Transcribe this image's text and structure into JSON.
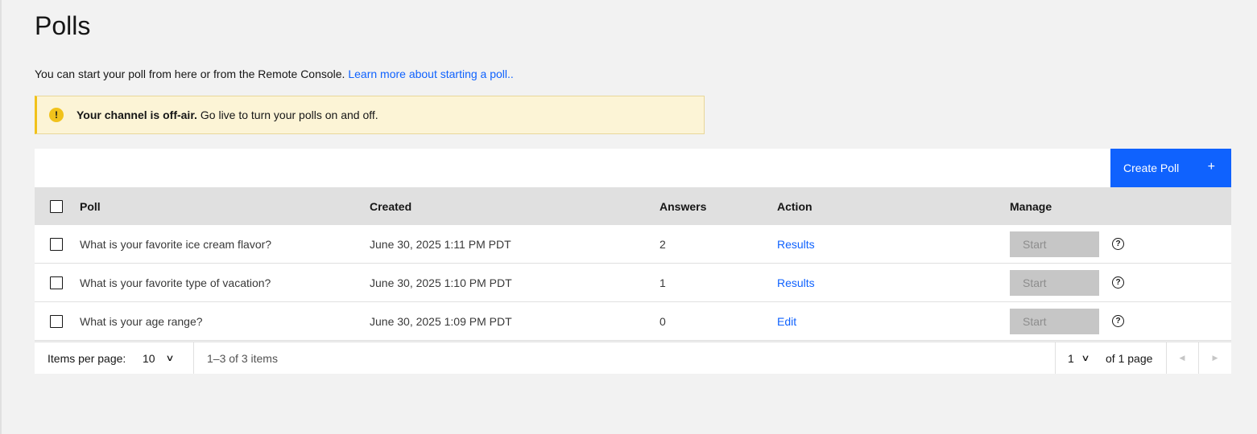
{
  "page": {
    "title": "Polls",
    "intro_text": "You can start your poll from here or from the Remote Console.",
    "intro_link": "Learn more about starting a poll.."
  },
  "banner": {
    "icon": "warning-icon",
    "title": "Your channel is off-air.",
    "message": "Go live to turn your polls on and off."
  },
  "toolbar": {
    "create_label": "Create Poll",
    "create_icon": "+"
  },
  "table": {
    "headers": {
      "poll": "Poll",
      "created": "Created",
      "answers": "Answers",
      "action": "Action",
      "manage": "Manage"
    },
    "rows": [
      {
        "poll": "What is your favorite ice cream flavor?",
        "created": "June 30, 2025 1:11 PM PDT",
        "answers": "2",
        "action": "Results",
        "manage": "Start",
        "help": "?"
      },
      {
        "poll": "What is your favorite type of vacation?",
        "created": "June 30, 2025 1:10 PM PDT",
        "answers": "1",
        "action": "Results",
        "manage": "Start",
        "help": "?"
      },
      {
        "poll": "What is your age range?",
        "created": "June 30, 2025 1:09 PM PDT",
        "answers": "0",
        "action": "Edit",
        "manage": "Start",
        "help": "?"
      }
    ]
  },
  "pagination": {
    "items_per_page_label": "Items per page:",
    "items_per_page_value": "10",
    "range_text": "1–3 of 3 items",
    "page_value": "1",
    "of_pages": "of 1 page",
    "chevron": "∨",
    "prev_icon": "◀",
    "next_icon": "▶"
  },
  "colors": {
    "accent": "#0f62fe",
    "warning": "#f1c21b",
    "banner_bg": "#fcf4d6",
    "disabled_button": "#c6c6c6"
  }
}
